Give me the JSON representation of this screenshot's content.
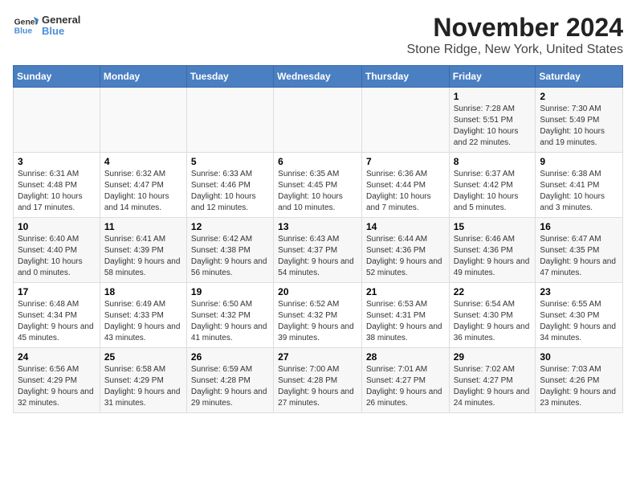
{
  "logo": {
    "line1": "General",
    "line2": "Blue"
  },
  "title": "November 2024",
  "location": "Stone Ridge, New York, United States",
  "weekdays": [
    "Sunday",
    "Monday",
    "Tuesday",
    "Wednesday",
    "Thursday",
    "Friday",
    "Saturday"
  ],
  "weeks": [
    [
      {
        "day": "",
        "info": ""
      },
      {
        "day": "",
        "info": ""
      },
      {
        "day": "",
        "info": ""
      },
      {
        "day": "",
        "info": ""
      },
      {
        "day": "",
        "info": ""
      },
      {
        "day": "1",
        "info": "Sunrise: 7:28 AM\nSunset: 5:51 PM\nDaylight: 10 hours and 22 minutes."
      },
      {
        "day": "2",
        "info": "Sunrise: 7:30 AM\nSunset: 5:49 PM\nDaylight: 10 hours and 19 minutes."
      }
    ],
    [
      {
        "day": "3",
        "info": "Sunrise: 6:31 AM\nSunset: 4:48 PM\nDaylight: 10 hours and 17 minutes."
      },
      {
        "day": "4",
        "info": "Sunrise: 6:32 AM\nSunset: 4:47 PM\nDaylight: 10 hours and 14 minutes."
      },
      {
        "day": "5",
        "info": "Sunrise: 6:33 AM\nSunset: 4:46 PM\nDaylight: 10 hours and 12 minutes."
      },
      {
        "day": "6",
        "info": "Sunrise: 6:35 AM\nSunset: 4:45 PM\nDaylight: 10 hours and 10 minutes."
      },
      {
        "day": "7",
        "info": "Sunrise: 6:36 AM\nSunset: 4:44 PM\nDaylight: 10 hours and 7 minutes."
      },
      {
        "day": "8",
        "info": "Sunrise: 6:37 AM\nSunset: 4:42 PM\nDaylight: 10 hours and 5 minutes."
      },
      {
        "day": "9",
        "info": "Sunrise: 6:38 AM\nSunset: 4:41 PM\nDaylight: 10 hours and 3 minutes."
      }
    ],
    [
      {
        "day": "10",
        "info": "Sunrise: 6:40 AM\nSunset: 4:40 PM\nDaylight: 10 hours and 0 minutes."
      },
      {
        "day": "11",
        "info": "Sunrise: 6:41 AM\nSunset: 4:39 PM\nDaylight: 9 hours and 58 minutes."
      },
      {
        "day": "12",
        "info": "Sunrise: 6:42 AM\nSunset: 4:38 PM\nDaylight: 9 hours and 56 minutes."
      },
      {
        "day": "13",
        "info": "Sunrise: 6:43 AM\nSunset: 4:37 PM\nDaylight: 9 hours and 54 minutes."
      },
      {
        "day": "14",
        "info": "Sunrise: 6:44 AM\nSunset: 4:36 PM\nDaylight: 9 hours and 52 minutes."
      },
      {
        "day": "15",
        "info": "Sunrise: 6:46 AM\nSunset: 4:36 PM\nDaylight: 9 hours and 49 minutes."
      },
      {
        "day": "16",
        "info": "Sunrise: 6:47 AM\nSunset: 4:35 PM\nDaylight: 9 hours and 47 minutes."
      }
    ],
    [
      {
        "day": "17",
        "info": "Sunrise: 6:48 AM\nSunset: 4:34 PM\nDaylight: 9 hours and 45 minutes."
      },
      {
        "day": "18",
        "info": "Sunrise: 6:49 AM\nSunset: 4:33 PM\nDaylight: 9 hours and 43 minutes."
      },
      {
        "day": "19",
        "info": "Sunrise: 6:50 AM\nSunset: 4:32 PM\nDaylight: 9 hours and 41 minutes."
      },
      {
        "day": "20",
        "info": "Sunrise: 6:52 AM\nSunset: 4:32 PM\nDaylight: 9 hours and 39 minutes."
      },
      {
        "day": "21",
        "info": "Sunrise: 6:53 AM\nSunset: 4:31 PM\nDaylight: 9 hours and 38 minutes."
      },
      {
        "day": "22",
        "info": "Sunrise: 6:54 AM\nSunset: 4:30 PM\nDaylight: 9 hours and 36 minutes."
      },
      {
        "day": "23",
        "info": "Sunrise: 6:55 AM\nSunset: 4:30 PM\nDaylight: 9 hours and 34 minutes."
      }
    ],
    [
      {
        "day": "24",
        "info": "Sunrise: 6:56 AM\nSunset: 4:29 PM\nDaylight: 9 hours and 32 minutes."
      },
      {
        "day": "25",
        "info": "Sunrise: 6:58 AM\nSunset: 4:29 PM\nDaylight: 9 hours and 31 minutes."
      },
      {
        "day": "26",
        "info": "Sunrise: 6:59 AM\nSunset: 4:28 PM\nDaylight: 9 hours and 29 minutes."
      },
      {
        "day": "27",
        "info": "Sunrise: 7:00 AM\nSunset: 4:28 PM\nDaylight: 9 hours and 27 minutes."
      },
      {
        "day": "28",
        "info": "Sunrise: 7:01 AM\nSunset: 4:27 PM\nDaylight: 9 hours and 26 minutes."
      },
      {
        "day": "29",
        "info": "Sunrise: 7:02 AM\nSunset: 4:27 PM\nDaylight: 9 hours and 24 minutes."
      },
      {
        "day": "30",
        "info": "Sunrise: 7:03 AM\nSunset: 4:26 PM\nDaylight: 9 hours and 23 minutes."
      }
    ]
  ]
}
